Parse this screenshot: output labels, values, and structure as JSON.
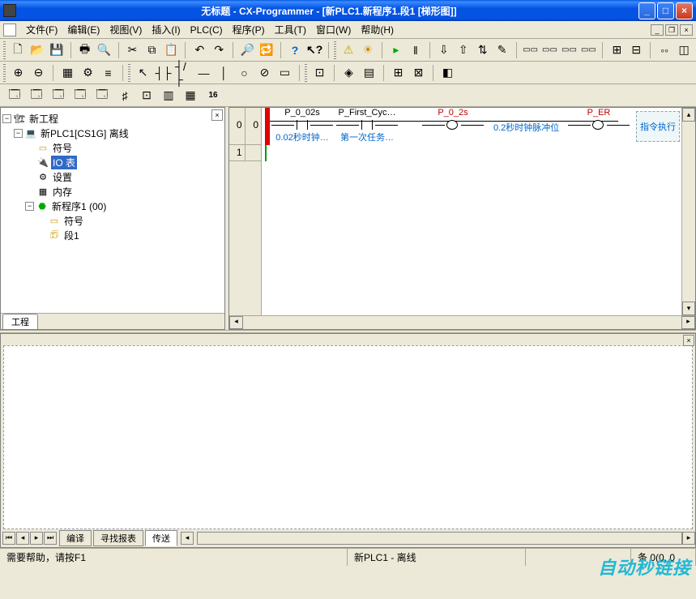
{
  "title": "无标题 - CX-Programmer - [新PLC1.新程序1.段1 [梯形图]]",
  "menus": {
    "file": "文件(F)",
    "edit": "编辑(E)",
    "view": "视图(V)",
    "insert": "插入(I)",
    "plc": "PLC(C)",
    "program": "程序(P)",
    "tools": "工具(T)",
    "window": "窗口(W)",
    "help": "帮助(H)"
  },
  "tree": {
    "root": "新工程",
    "plc": "新PLC1[CS1G] 离线",
    "symbols": "符号",
    "io_table": "IO 表",
    "settings": "设置",
    "memory": "内存",
    "program": "新程序1 (00)",
    "prog_symbols": "符号",
    "section": "段1"
  },
  "left_tab": "工程",
  "ladder": {
    "rung0_num": "0",
    "rung0_addr": "0",
    "rung1_num": "1",
    "c1_top": "P_0_02s",
    "c1_bot": "0.02秒时钟…",
    "c2_top": "P_First_Cyc…",
    "c2_bot": "第一次任务…",
    "c3_top": "P_0_2s",
    "c3_bot": "",
    "comment": "0.2秒时钟脉冲位",
    "c4_top": "P_ER",
    "instr": "指令执行"
  },
  "output_tabs": {
    "compile": "编译",
    "find": "寻找报表",
    "transfer": "传送"
  },
  "status": {
    "help": "需要帮助，请按F1",
    "plc": "新PLC1 - 离线",
    "pos": "条 0(0, 0"
  },
  "watermark": "自动秒链接"
}
